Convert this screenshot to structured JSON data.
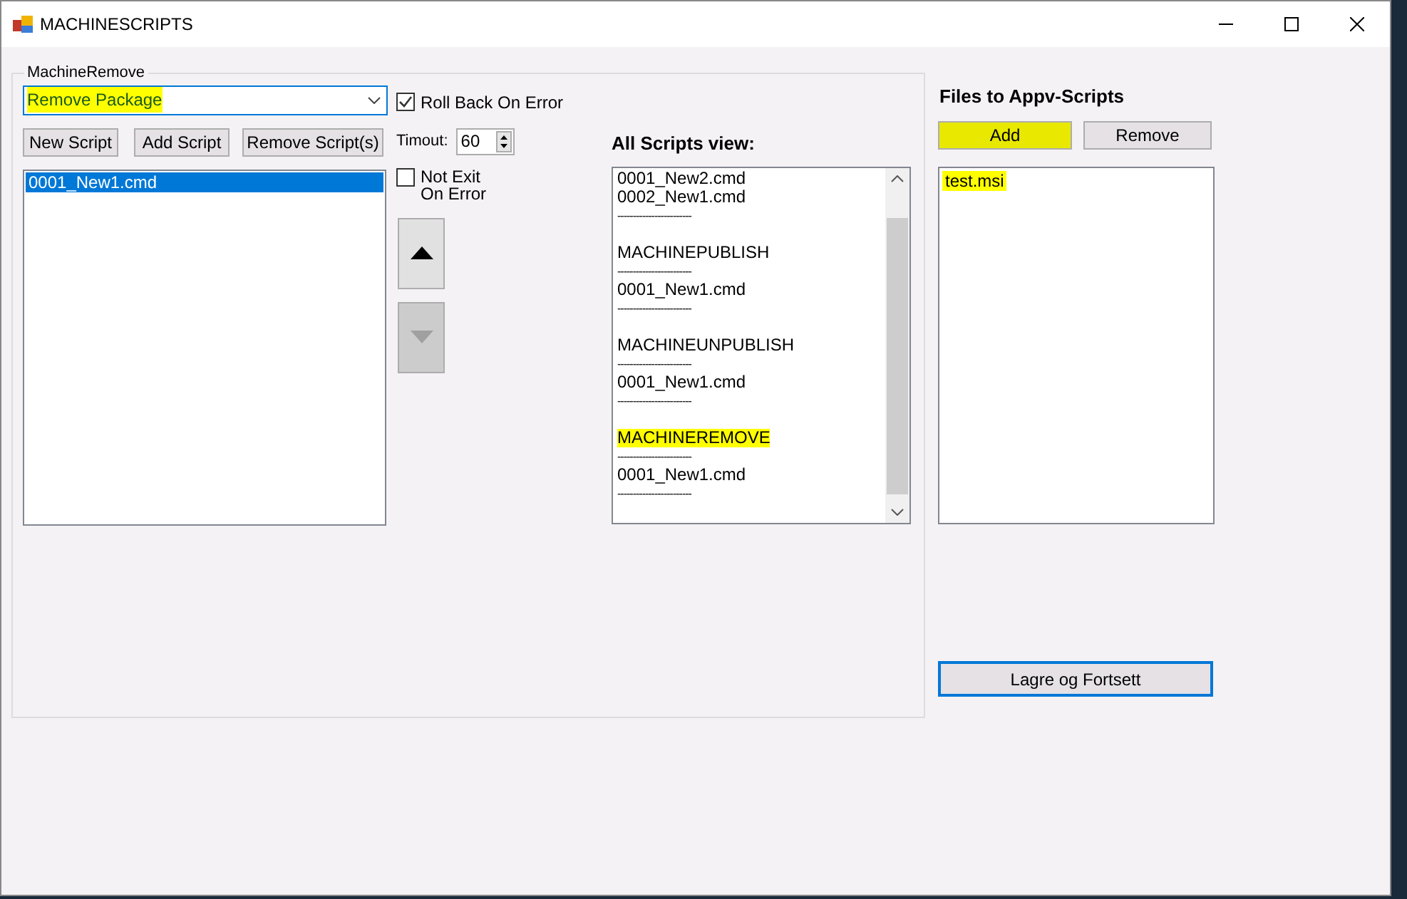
{
  "window": {
    "title": "MACHINESCRIPTS"
  },
  "group": {
    "title": "MachineRemove",
    "combo": {
      "value": "Remove Package",
      "highlighted": true
    },
    "buttons": [
      {
        "label": "New Script"
      },
      {
        "label": "Add Script"
      },
      {
        "label": "Remove Script(s)"
      }
    ],
    "scripts": [
      {
        "label": "0001_New1.cmd",
        "selected": true
      }
    ],
    "roll_back": {
      "label": "Roll Back On Error",
      "checked": true
    },
    "timeout": {
      "label": "Timout:",
      "value": "60"
    },
    "not_exit": {
      "label": "Not Exit On Error",
      "checked": false
    },
    "move_buttons": [
      {
        "kind": "up",
        "disabled": false
      },
      {
        "kind": "down",
        "disabled": true
      }
    ],
    "all_scripts": {
      "title": "All Scripts view:",
      "lines": [
        {
          "kind": "text",
          "text": "0001_New2.cmd",
          "highlighted": false
        },
        {
          "kind": "text",
          "text": "0002_New1.cmd",
          "highlighted": false
        },
        {
          "kind": "text",
          "text": "------------------------",
          "highlighted": false
        },
        {
          "kind": "gap"
        },
        {
          "kind": "text",
          "text": "MACHINEPUBLISH",
          "highlighted": false
        },
        {
          "kind": "text",
          "text": "------------------------",
          "highlighted": false
        },
        {
          "kind": "text",
          "text": "0001_New1.cmd",
          "highlighted": false
        },
        {
          "kind": "text",
          "text": "------------------------",
          "highlighted": false
        },
        {
          "kind": "gap"
        },
        {
          "kind": "text",
          "text": "MACHINEUNPUBLISH",
          "highlighted": false
        },
        {
          "kind": "text",
          "text": "------------------------",
          "highlighted": false
        },
        {
          "kind": "text",
          "text": "0001_New1.cmd",
          "highlighted": false
        },
        {
          "kind": "text",
          "text": "------------------------",
          "highlighted": false
        },
        {
          "kind": "gap"
        },
        {
          "kind": "text",
          "text": "MACHINEREMOVE",
          "highlighted": true
        },
        {
          "kind": "text",
          "text": "------------------------",
          "highlighted": false
        },
        {
          "kind": "text",
          "text": "0001_New1.cmd",
          "highlighted": false
        },
        {
          "kind": "text",
          "text": "------------------------",
          "highlighted": false
        }
      ]
    }
  },
  "files": {
    "title": "Files to Appv-Scripts",
    "buttons": [
      {
        "label": "Add",
        "highlighted": true
      },
      {
        "label": "Remove",
        "highlighted": false
      }
    ],
    "items": [
      {
        "label": "test.msi",
        "highlighted": true
      }
    ]
  },
  "save_button": {
    "label": "Lagre og Fortsett"
  }
}
